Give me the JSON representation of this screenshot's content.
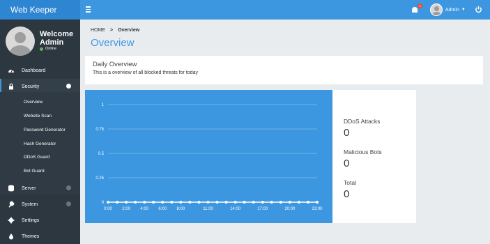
{
  "app": {
    "brand": "Web Keeper"
  },
  "topbar": {
    "notification_count": "0",
    "user_name": "Admin",
    "colors": {
      "brand_bg": "#2e86d2",
      "nav_bg": "#3c97e0",
      "badge": "#e74c3c"
    },
    "icons": [
      "menu-icon",
      "bell-icon",
      "caret-down-icon",
      "power-icon"
    ]
  },
  "sidebar": {
    "welcome": "Welcome",
    "user": "Admin",
    "status": "Online",
    "items": [
      {
        "label": "Dashboard",
        "icon": "dashboard-icon"
      },
      {
        "label": "Security",
        "icon": "lock-icon",
        "expanded": true
      },
      {
        "label": "Server",
        "icon": "server-icon"
      },
      {
        "label": "System",
        "icon": "wrench-icon"
      },
      {
        "label": "Settings",
        "icon": "gear-icon"
      },
      {
        "label": "Themes",
        "icon": "drop-icon"
      }
    ],
    "security_sub": [
      {
        "label": "Overview"
      },
      {
        "label": "Website Scan"
      },
      {
        "label": "Password Generator"
      },
      {
        "label": "Hash Generator"
      },
      {
        "label": "DDoS Guard"
      },
      {
        "label": "Bot Guard"
      }
    ]
  },
  "breadcrumb": {
    "home": "HOME",
    "separator": ">",
    "current": "Overview"
  },
  "page": {
    "title": "Overview"
  },
  "daily": {
    "heading": "Daily Overview",
    "subtitle": "This is a overview of all blocked threats for today"
  },
  "stats": [
    {
      "label": "DDoS Attacks",
      "value": "0"
    },
    {
      "label": "Malicious Bots",
      "value": "0"
    },
    {
      "label": "Total",
      "value": "0"
    }
  ],
  "chart_data": {
    "type": "line",
    "x": [
      "0:00",
      "1:00",
      "2:00",
      "3:00",
      "4:00",
      "5:00",
      "6:00",
      "7:00",
      "8:00",
      "9:00",
      "10:00",
      "11:00",
      "12:00",
      "13:00",
      "14:00",
      "15:00",
      "16:00",
      "17:00",
      "18:00",
      "19:00",
      "20:00",
      "21:00",
      "22:00",
      "23:00"
    ],
    "x_tick_labels": [
      "0:00",
      "2:00",
      "4:00",
      "6:00",
      "8:00",
      "11:00",
      "14:00",
      "17:00",
      "20:00",
      "23:00"
    ],
    "series": [
      {
        "values": [
          0,
          0,
          0,
          0,
          0,
          0,
          0,
          0,
          0,
          0,
          0,
          0,
          0,
          0,
          0,
          0,
          0,
          0,
          0,
          0,
          0,
          0,
          0,
          0
        ]
      }
    ],
    "y_ticks": [
      "0",
      "0.25",
      "0.5",
      "0.75",
      "1"
    ],
    "ylim": [
      0,
      1
    ],
    "grid": true,
    "colors": {
      "background": "#3c97e0",
      "line": "#ffffff",
      "grid": "#7fbaea"
    }
  }
}
